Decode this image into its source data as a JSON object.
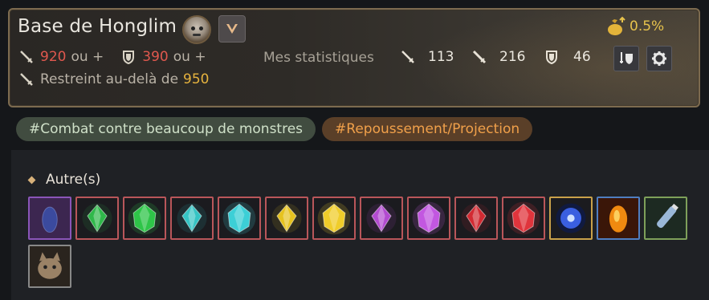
{
  "header": {
    "title": "Base de Honglim",
    "boss_icon": "boss-face-icon",
    "expand_icon": "chevron-down-icon",
    "gold_rate": "0.5%",
    "requirements": {
      "ap": "920",
      "ap_suffix": "ou +",
      "dp": "390",
      "dp_suffix": "ou +",
      "restricted_label": "Restreint au-delà de",
      "restricted_value": "950"
    },
    "my_stats": {
      "label": "Mes statistiques",
      "ap": "113",
      "aap": "216",
      "dp": "46"
    }
  },
  "tags": [
    "#Combat contre beaucoup de monstres",
    "#Repoussement/Projection"
  ],
  "drops": {
    "section_title": "Autre(s)",
    "items": [
      {
        "icon": "dark-blue-stone-icon",
        "border": "#8a55b8",
        "color": "#3b4a9e"
      },
      {
        "icon": "green-crystal-icon",
        "border": "#b9565a",
        "color": "#2fb84a"
      },
      {
        "icon": "green-crystal-cluster-icon",
        "border": "#b9565a",
        "color": "#2ec548"
      },
      {
        "icon": "cyan-crystal-icon",
        "border": "#b9565a",
        "color": "#35c4c4"
      },
      {
        "icon": "cyan-crystal-cluster-icon",
        "border": "#b9565a",
        "color": "#3ccfd6"
      },
      {
        "icon": "yellow-crystal-icon",
        "border": "#b9565a",
        "color": "#e6c21f"
      },
      {
        "icon": "yellow-crystal-cluster-icon",
        "border": "#b9565a",
        "color": "#f0cd2a"
      },
      {
        "icon": "purple-crystal-icon",
        "border": "#b9565a",
        "color": "#b24bd0"
      },
      {
        "icon": "purple-crystal-cluster-icon",
        "border": "#b9565a",
        "color": "#c257e0"
      },
      {
        "icon": "red-crystal-icon",
        "border": "#b9565a",
        "color": "#d22a32"
      },
      {
        "icon": "red-crystal-cluster-icon",
        "border": "#b9565a",
        "color": "#e0343c"
      },
      {
        "icon": "blue-orb-icon",
        "border": "#c9a14a",
        "color": "#3a5fe0"
      },
      {
        "icon": "fire-gem-icon",
        "border": "#4f7ec0",
        "color": "#f08a10"
      },
      {
        "icon": "potion-vial-icon",
        "border": "#7ea05a",
        "color": "#9ab8d8"
      },
      {
        "icon": "cat-pet-icon",
        "border": "#888888",
        "color": "#9a8266"
      }
    ]
  }
}
